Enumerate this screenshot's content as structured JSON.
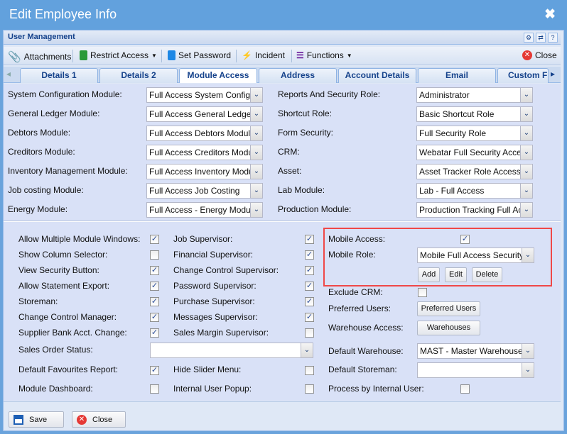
{
  "window": {
    "title": "Edit Employee Info",
    "close": "✖"
  },
  "panel": {
    "title": "User Management"
  },
  "toolbar": {
    "attachments": "Attachments",
    "restrict_access": "Restrict Access",
    "set_password": "Set Password",
    "incident": "Incident",
    "functions": "Functions",
    "close": "Close"
  },
  "tabs": [
    "Details 1",
    "Details 2",
    "Module Access",
    "Address",
    "Account Details",
    "Email",
    "Custom Fi"
  ],
  "modules_left": [
    {
      "label": "System Configuration Module:",
      "value": "Full Access System Config"
    },
    {
      "label": "General Ledger Module:",
      "value": "Full Access General Ledger"
    },
    {
      "label": "Debtors Module:",
      "value": "Full Access Debtors Module"
    },
    {
      "label": "Creditors Module:",
      "value": "Full Access Creditors Module"
    },
    {
      "label": "Inventory Management Module:",
      "value": "Full Access Inventory Module"
    },
    {
      "label": "Job costing Module:",
      "value": "Full Access Job Costing"
    },
    {
      "label": "Energy Module:",
      "value": "Full Access - Energy Module"
    }
  ],
  "modules_right": [
    {
      "label": "Reports And Security Role:",
      "value": "Administrator"
    },
    {
      "label": "Shortcut Role:",
      "value": "Basic Shortcut Role"
    },
    {
      "label": "Form Security:",
      "value": "Full Security Role"
    },
    {
      "label": "CRM:",
      "value": "Webatar Full Security Access"
    },
    {
      "label": "Asset:",
      "value": "Asset Tracker Role Access"
    },
    {
      "label": "Lab Module:",
      "value": "Lab - Full Access"
    },
    {
      "label": "Production Module:",
      "value": "Production Tracking Full Access"
    }
  ],
  "checks_col1": [
    {
      "label": "Allow Multiple Module Windows:",
      "checked": true
    },
    {
      "label": "Show Column Selector:",
      "checked": false
    },
    {
      "label": "View Security Button:",
      "checked": true
    },
    {
      "label": "Allow Statement Export:",
      "checked": true
    },
    {
      "label": "Storeman:",
      "checked": true
    },
    {
      "label": "Change Control Manager:",
      "checked": true
    },
    {
      "label": "Supplier Bank Acct. Change:",
      "checked": true
    }
  ],
  "checks_col2": [
    {
      "label": "Job Supervisor:",
      "checked": true
    },
    {
      "label": "Financial Supervisor:",
      "checked": true
    },
    {
      "label": "Change Control Supervisor:",
      "checked": true
    },
    {
      "label": "Password Supervisor:",
      "checked": true
    },
    {
      "label": "Purchase Supervisor:",
      "checked": true
    },
    {
      "label": "Messages Supervisor:",
      "checked": true
    },
    {
      "label": "Sales Margin Supervisor:",
      "checked": false
    }
  ],
  "sales_order_status": {
    "label": "Sales Order Status:",
    "value": ""
  },
  "default_fav": {
    "label": "Default Favourites Report:",
    "checked": true
  },
  "hide_slider": {
    "label": "Hide Slider Menu:",
    "checked": false
  },
  "module_dashboard": {
    "label": "Module Dashboard:",
    "checked": false
  },
  "internal_popup": {
    "label": "Internal User Popup:",
    "checked": false
  },
  "mobile": {
    "access_label": "Mobile Access:",
    "access_checked": true,
    "role_label": "Mobile Role:",
    "role_value": "Mobile Full Access Security",
    "add": "Add",
    "edit": "Edit",
    "delete": "Delete"
  },
  "exclude_crm": {
    "label": "Exclude CRM:",
    "checked": false
  },
  "preferred_users": {
    "label": "Preferred Users:",
    "button": "Preferred Users"
  },
  "warehouse_access": {
    "label": "Warehouse Access:",
    "button": "Warehouses"
  },
  "default_warehouse": {
    "label": "Default Warehouse:",
    "value": "MAST - Master Warehouse"
  },
  "default_storeman": {
    "label": "Default Storeman:",
    "value": ""
  },
  "process_internal": {
    "label": "Process by Internal User:",
    "checked": false
  },
  "footer": {
    "save": "Save",
    "close": "Close"
  }
}
